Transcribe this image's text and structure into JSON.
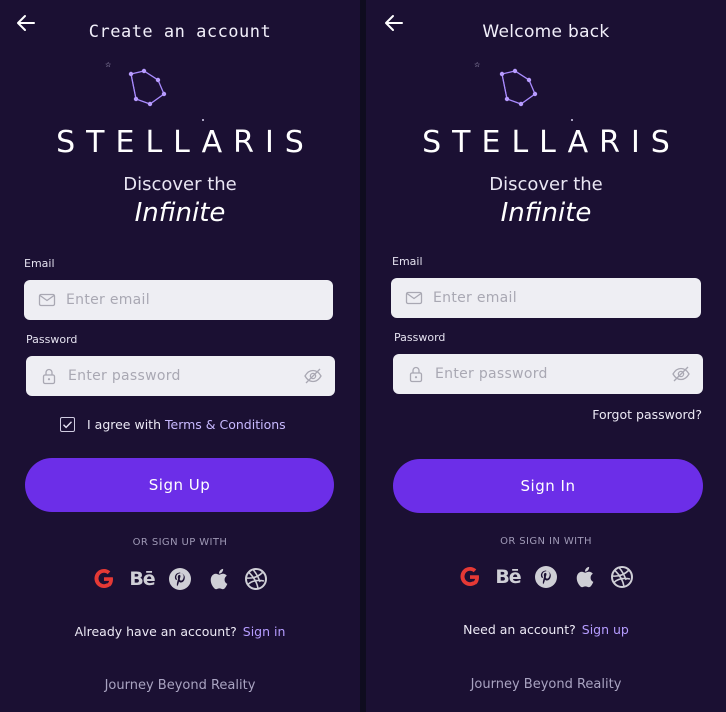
{
  "signup": {
    "title": "Create an account",
    "brand": "STELLARIS",
    "tagline_1": "Discover the",
    "tagline_2": "Infinite",
    "email_label": "Email",
    "email_placeholder": "Enter email",
    "password_label": "Password",
    "password_placeholder": "Enter password",
    "agree_text": "I agree with",
    "terms_link": "Terms & Conditions",
    "agree_checked": true,
    "button_label": "Sign Up",
    "or_text": "OR SIGN UP WITH",
    "account_text": "Already have an account?",
    "account_link": "Sign in",
    "footer": "Journey Beyond Reality"
  },
  "signin": {
    "title": "Welcome back",
    "brand": "STELLARIS",
    "tagline_1": "Discover the",
    "tagline_2": "Infinite",
    "email_label": "Email",
    "email_placeholder": "Enter email",
    "password_label": "Password",
    "password_placeholder": "Enter password",
    "forgot_link": "Forgot password?",
    "button_label": "Sign In",
    "or_text": "OR SIGN IN WITH",
    "account_text": "Need an account?",
    "account_link": "Sign up",
    "footer": "Journey Beyond Reality"
  },
  "socials": [
    "google-icon",
    "behance-icon",
    "pinterest-icon",
    "apple-icon",
    "dribbble-icon"
  ],
  "behance_glyph": "Bē",
  "colors": {
    "background": "#1b1033",
    "accent": "#6c2ee8",
    "link": "#b59cff",
    "field": "#eeeef3",
    "google_red": "#e53935"
  }
}
